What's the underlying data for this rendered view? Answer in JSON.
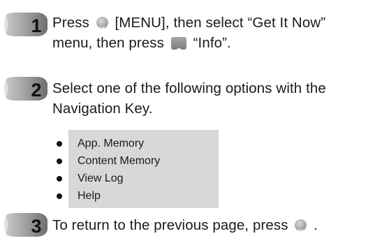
{
  "steps": [
    {
      "number": "1",
      "line1_before": "Press",
      "line1_key": "[MENU], then select “Get It Now”",
      "line2_before": "menu, then press",
      "line2_after": "“Info”."
    },
    {
      "number": "2",
      "line1": "Select one of the following options with the",
      "line2": "Navigation Key."
    },
    {
      "number": "3",
      "text": "To return to the previous page, press",
      "end": "."
    }
  ],
  "options": [
    "App. Memory",
    "Content Memory",
    "View Log",
    "Help"
  ],
  "icons": {
    "ok_key": "ok-key-icon",
    "menu_key": "ellipsis-key-icon",
    "step_badge": "numbered-step-badge-icon"
  },
  "colors": {
    "text": "#1b1b1b",
    "option_box": "#d8d8d8",
    "badge_dark": "#6a6a6a",
    "badge_light": "#c4c4c4"
  }
}
